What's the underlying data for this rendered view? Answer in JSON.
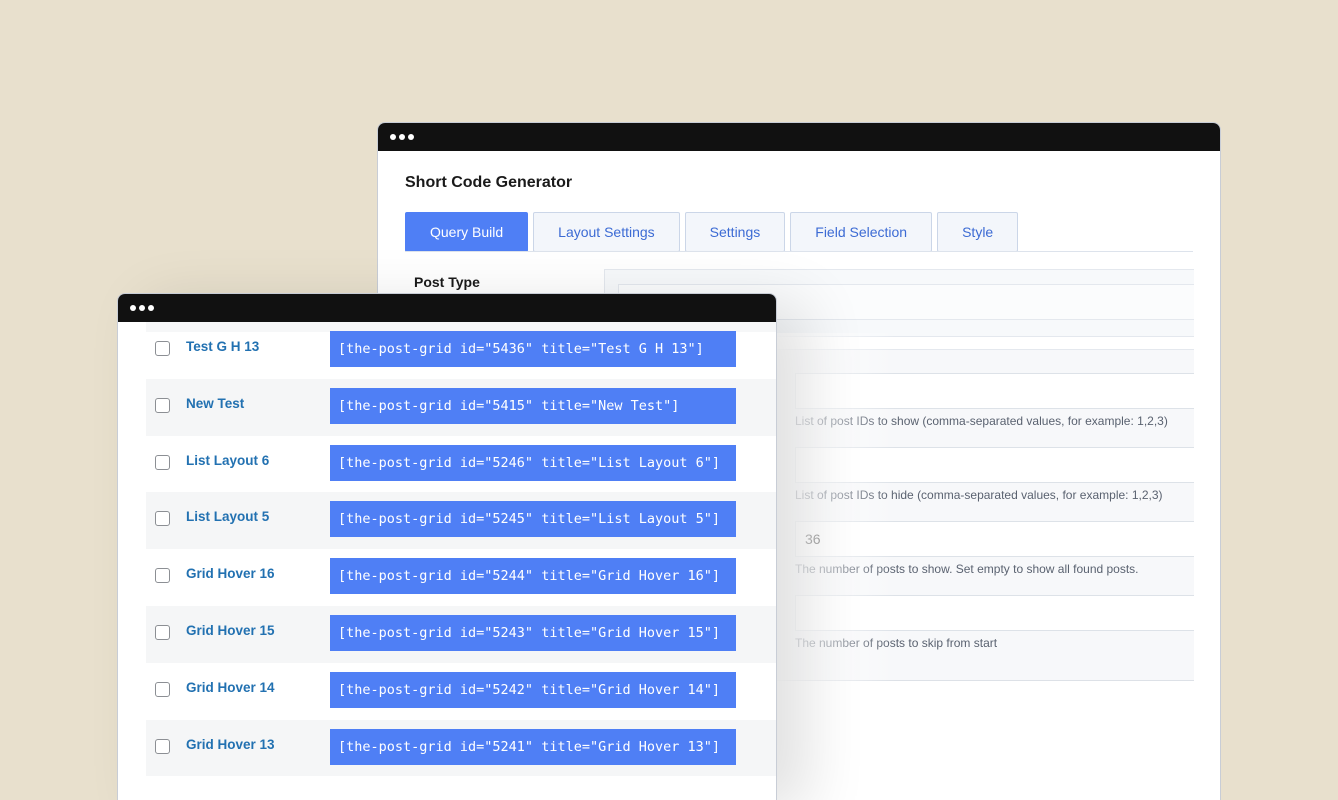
{
  "colors": {
    "background": "#e8e0cd",
    "accent": "#4f7ff5",
    "link": "#2271b1",
    "titlebar": "#111111"
  },
  "back_window": {
    "title": "Short Code Generator",
    "tabs": [
      {
        "label": "Query Build",
        "active": true
      },
      {
        "label": "Layout Settings",
        "active": false
      },
      {
        "label": "Settings",
        "active": false
      },
      {
        "label": "Field Selection",
        "active": false
      },
      {
        "label": "Style",
        "active": false
      }
    ],
    "post_type_label": "Post Type",
    "fields": [
      {
        "value": "",
        "hint": "List of post IDs to show (comma-separated values, for example: 1,2,3)"
      },
      {
        "value": "",
        "hint": "List of post IDs to hide (comma-separated values, for example: 1,2,3)"
      },
      {
        "value": "36",
        "hint": "The number of posts to show. Set empty to show all found posts."
      },
      {
        "value": "",
        "hint": "The number of posts to skip from start"
      }
    ]
  },
  "front_window": {
    "rows": [
      {
        "title": "Test G H 13",
        "shortcode": "[the-post-grid id=\"5436\" title=\"Test G H 13\"]"
      },
      {
        "title": "New Test",
        "shortcode": "[the-post-grid id=\"5415\" title=\"New Test\"]"
      },
      {
        "title": "List Layout 6",
        "shortcode": "[the-post-grid id=\"5246\" title=\"List Layout 6\"]"
      },
      {
        "title": "List Layout 5",
        "shortcode": "[the-post-grid id=\"5245\" title=\"List Layout 5\"]"
      },
      {
        "title": "Grid Hover 16",
        "shortcode": "[the-post-grid id=\"5244\" title=\"Grid Hover 16\"]"
      },
      {
        "title": "Grid Hover 15",
        "shortcode": "[the-post-grid id=\"5243\" title=\"Grid Hover 15\"]"
      },
      {
        "title": "Grid Hover 14",
        "shortcode": "[the-post-grid id=\"5242\" title=\"Grid Hover 14\"]"
      },
      {
        "title": "Grid Hover 13",
        "shortcode": "[the-post-grid id=\"5241\" title=\"Grid Hover 13\"]"
      }
    ]
  }
}
